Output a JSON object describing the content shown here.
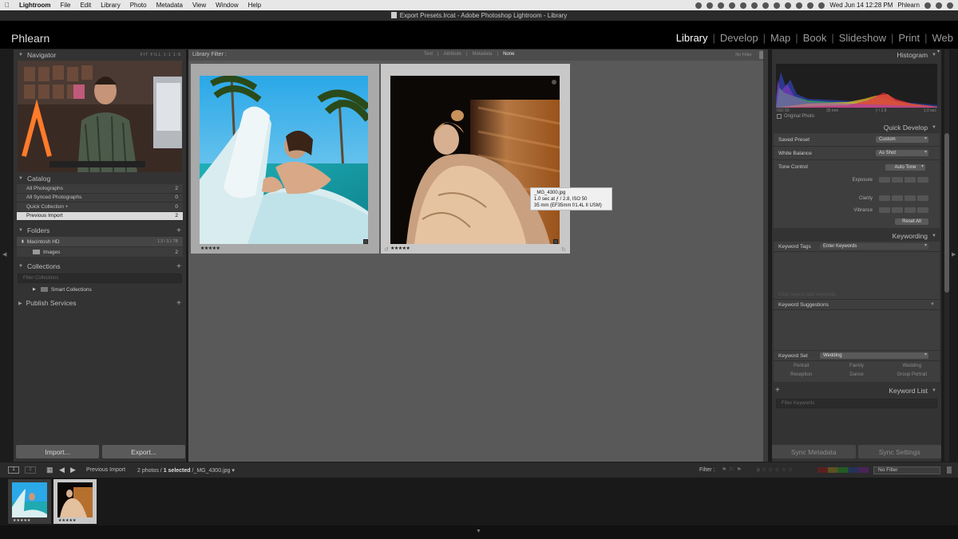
{
  "menubar": {
    "app": "Lightroom",
    "items": [
      "File",
      "Edit",
      "Library",
      "Photo",
      "Metadata",
      "View",
      "Window",
      "Help"
    ],
    "clock": "Wed Jun 14  12:28 PM",
    "user": "Phlearn"
  },
  "window": {
    "title": "Export Presets.lrcat - Adobe Photoshop Lightroom - Library"
  },
  "identity_plate": "Phlearn",
  "modules": [
    "Library",
    "Develop",
    "Map",
    "Book",
    "Slideshow",
    "Print",
    "Web"
  ],
  "active_module": "Library",
  "left_panel": {
    "navigator": {
      "title": "Navigator",
      "zoom_opts": "FIT  FILL  1:1  1:8"
    },
    "catalog": {
      "title": "Catalog",
      "rows": [
        {
          "label": "All Photographs",
          "count": "2"
        },
        {
          "label": "All Synced Photographs",
          "count": "0"
        },
        {
          "label": "Quick Collection +",
          "count": "0"
        },
        {
          "label": "Previous Import",
          "count": "2"
        }
      ]
    },
    "folders": {
      "title": "Folders",
      "volume": "Macintosh HD",
      "volume_size": "1.3 / 3.1 TB",
      "items": [
        {
          "label": "Images",
          "count": "2"
        }
      ]
    },
    "collections": {
      "title": "Collections",
      "search_placeholder": "Filter Collections",
      "items": [
        "Smart Collections"
      ]
    },
    "publish": {
      "title": "Publish Services"
    },
    "import_label": "Import...",
    "export_label": "Export..."
  },
  "filter_bar": {
    "label": "Library Filter :",
    "options": [
      "Text",
      "Attribute",
      "Metadata",
      "None"
    ],
    "active": "None",
    "preset": "No Filter"
  },
  "grid": {
    "photos": [
      {
        "name": "pool-photo",
        "rating": "★★★★★"
      },
      {
        "name": "fur-coat-photo",
        "rating": "★★★★★"
      }
    ],
    "tooltip": {
      "line1": "_MG_4300.jpg",
      "line2": "1.0 sec at ƒ / 2.8, ISO 50",
      "line3": "35 mm (EF35mm f/1.4L II USM)"
    }
  },
  "right_panel": {
    "histogram": {
      "title": "Histogram",
      "iso": "ISO 50",
      "focal": "35 mm",
      "aperture": "ƒ / 2.8",
      "shutter": "1.0 sec",
      "original_photo": "Original Photo"
    },
    "quick_develop": {
      "title": "Quick Develop",
      "saved_preset_label": "Saved Preset",
      "saved_preset_value": "Custom",
      "white_balance_label": "White Balance",
      "white_balance_value": "As Shot",
      "tone_control_label": "Tone Control",
      "auto_tone": "Auto Tone",
      "exposure": "Exposure",
      "clarity": "Clarity",
      "vibrance": "Vibrance",
      "reset_all": "Reset All"
    },
    "keywording": {
      "title": "Keywording",
      "tags_label": "Keyword Tags",
      "tags_value": "Enter Keywords",
      "click_hint": "Click here to add keywords",
      "suggestions_label": "Keyword Suggestions",
      "set_label": "Keyword Set",
      "set_value": "Wedding",
      "set_keywords": [
        "Portrait",
        "Family",
        "Wedding",
        "Reception",
        "Dance",
        "Group Portrait"
      ]
    },
    "keyword_list": {
      "title": "Keyword List",
      "search_placeholder": "Filter Keywords"
    },
    "sync_metadata": "Sync Metadata",
    "sync_settings": "Sync Settings"
  },
  "filmstrip_bar": {
    "page1": "1",
    "page2": "2",
    "source": "Previous Import",
    "count_prefix": "2 photos /",
    "count_selected": "1 selected",
    "file": "/_MG_4300.jpg ▾",
    "filter_label": "Filter :",
    "filter_value": "No Filter"
  },
  "filmstrip": {
    "thumbs": [
      {
        "rating": "★★★★★"
      },
      {
        "rating": "★★★★★"
      }
    ]
  },
  "colors": {
    "accent": "#ffffff",
    "panel": "#333333",
    "grid_bg": "#595959"
  }
}
